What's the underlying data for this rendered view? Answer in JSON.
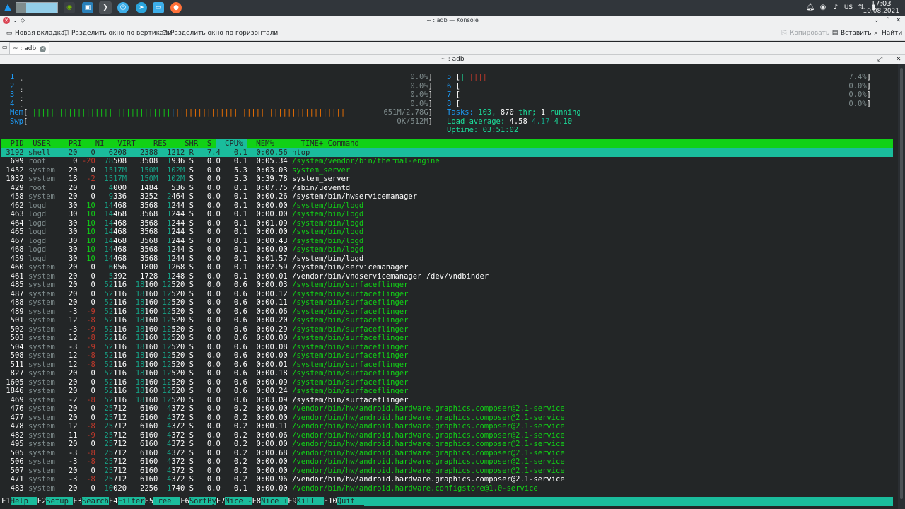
{
  "taskbar": {
    "clock_time": "17:03",
    "clock_date": "10.08.2021",
    "keyboard_layout": "US",
    "icons": [
      "kde-menu-icon",
      "desktop-pager-icon",
      "nvidia-icon",
      "terminal-app-icon",
      "konsole-icon",
      "browser-icon",
      "telegram-icon",
      "file-manager-icon",
      "firefox-icon"
    ],
    "tray_icons": [
      "notifications-icon",
      "media-icon",
      "volume-icon",
      "network-icon",
      "battery-icon"
    ]
  },
  "window": {
    "title": "~ : adb — Konsole"
  },
  "toolbar": {
    "new_tab": "Новая вкладка",
    "split_vertical": "Разделить окно по вертикали",
    "split_horizontal": "Разделить окно по горизонтали",
    "copy": "Копировать",
    "paste": "Вставить",
    "find": "Найти"
  },
  "tab": {
    "label": "~ : adb"
  },
  "session": {
    "title": "~ : adb"
  },
  "meters": {
    "cpus": [
      {
        "n": "1",
        "bar": "",
        "pct": "0.0%"
      },
      {
        "n": "2",
        "bar": "",
        "pct": "0.0%"
      },
      {
        "n": "3",
        "bar": "",
        "pct": "0.0%"
      },
      {
        "n": "4",
        "bar": "",
        "pct": "0.0%"
      },
      {
        "n": "5",
        "bar": "||||||",
        "pct": "7.4%"
      },
      {
        "n": "6",
        "bar": "",
        "pct": "0.0%"
      },
      {
        "n": "7",
        "bar": "",
        "pct": "0.0%"
      },
      {
        "n": "8",
        "bar": "",
        "pct": "0.0%"
      }
    ],
    "mem": {
      "label": "Mem",
      "bar_green": "||||||||||||||||||||||||||||||||",
      "bar_blue": "|",
      "bar_orange": "||||||||||||||||||||||||||||||||||||||",
      "value": "651M/2.78G"
    },
    "swp": {
      "label": "Swp",
      "value": "0K/512M"
    },
    "tasks": {
      "label": "Tasks:",
      "count": "103,",
      "thr": "870",
      "thr_label": "thr;",
      "running": "1",
      "running_label": "running"
    },
    "load": {
      "label": "Load average:",
      "l1": "4.58",
      "l5": "4.17",
      "l15": "4.10"
    },
    "uptime": {
      "label": "Uptime:",
      "value": "03:51:02"
    }
  },
  "columns": [
    "PID",
    "USER",
    "PRI",
    "NI",
    "VIRT",
    "RES",
    "SHR",
    "S",
    "CPU%",
    "MEM%",
    "TIME+",
    "Command"
  ],
  "processes": [
    [
      "3192",
      "shell",
      "20",
      "0",
      "6208",
      "2388",
      "1212",
      "R",
      "7.4",
      "0.1",
      "0:00.56",
      "htop"
    ],
    [
      "699",
      "root",
      "0",
      "-20",
      "78508",
      "3508",
      "1936",
      "S",
      "0.0",
      "0.1",
      "0:05.34",
      "/system/vendor/bin/thermal-engine"
    ],
    [
      "1452",
      "system",
      "20",
      "0",
      "1517M",
      "150M",
      "102M",
      "S",
      "0.0",
      "5.3",
      "0:03.03",
      "system_server"
    ],
    [
      "1032",
      "system",
      "18",
      "-2",
      "1517M",
      "150M",
      "102M",
      "S",
      "0.0",
      "5.3",
      "0:39.78",
      "system_server"
    ],
    [
      "429",
      "root",
      "20",
      "0",
      "4000",
      "1484",
      "536",
      "S",
      "0.0",
      "0.1",
      "0:07.75",
      "/sbin/ueventd"
    ],
    [
      "458",
      "system",
      "20",
      "0",
      "9336",
      "3252",
      "2464",
      "S",
      "0.0",
      "0.1",
      "0:00.26",
      "/system/bin/hwservicemanager"
    ],
    [
      "462",
      "logd",
      "30",
      "10",
      "14468",
      "3568",
      "1244",
      "S",
      "0.0",
      "0.1",
      "0:00.00",
      "/system/bin/logd"
    ],
    [
      "463",
      "logd",
      "30",
      "10",
      "14468",
      "3568",
      "1244",
      "S",
      "0.0",
      "0.1",
      "0:00.00",
      "/system/bin/logd"
    ],
    [
      "464",
      "logd",
      "30",
      "10",
      "14468",
      "3568",
      "1244",
      "S",
      "0.0",
      "0.1",
      "0:01.09",
      "/system/bin/logd"
    ],
    [
      "465",
      "logd",
      "30",
      "10",
      "14468",
      "3568",
      "1244",
      "S",
      "0.0",
      "0.1",
      "0:00.00",
      "/system/bin/logd"
    ],
    [
      "467",
      "logd",
      "30",
      "10",
      "14468",
      "3568",
      "1244",
      "S",
      "0.0",
      "0.1",
      "0:00.43",
      "/system/bin/logd"
    ],
    [
      "468",
      "logd",
      "30",
      "10",
      "14468",
      "3568",
      "1244",
      "S",
      "0.0",
      "0.1",
      "0:00.00",
      "/system/bin/logd"
    ],
    [
      "459",
      "logd",
      "30",
      "10",
      "14468",
      "3568",
      "1244",
      "S",
      "0.0",
      "0.1",
      "0:01.57",
      "/system/bin/logd"
    ],
    [
      "460",
      "system",
      "20",
      "0",
      "6056",
      "1800",
      "1268",
      "S",
      "0.0",
      "0.1",
      "0:02.59",
      "/system/bin/servicemanager"
    ],
    [
      "461",
      "system",
      "20",
      "0",
      "5392",
      "1728",
      "1248",
      "S",
      "0.0",
      "0.1",
      "0:00.01",
      "/vendor/bin/vndservicemanager /dev/vndbinder"
    ],
    [
      "485",
      "system",
      "20",
      "0",
      "52116",
      "18160",
      "12520",
      "S",
      "0.0",
      "0.6",
      "0:00.03",
      "/system/bin/surfaceflinger"
    ],
    [
      "487",
      "system",
      "20",
      "0",
      "52116",
      "18160",
      "12520",
      "S",
      "0.0",
      "0.6",
      "0:00.12",
      "/system/bin/surfaceflinger"
    ],
    [
      "488",
      "system",
      "20",
      "0",
      "52116",
      "18160",
      "12520",
      "S",
      "0.0",
      "0.6",
      "0:00.11",
      "/system/bin/surfaceflinger"
    ],
    [
      "489",
      "system",
      "-3",
      "-9",
      "52116",
      "18160",
      "12520",
      "S",
      "0.0",
      "0.6",
      "0:00.06",
      "/system/bin/surfaceflinger"
    ],
    [
      "501",
      "system",
      "12",
      "-8",
      "52116",
      "18160",
      "12520",
      "S",
      "0.0",
      "0.6",
      "0:00.20",
      "/system/bin/surfaceflinger"
    ],
    [
      "502",
      "system",
      "-3",
      "-9",
      "52116",
      "18160",
      "12520",
      "S",
      "0.0",
      "0.6",
      "0:00.29",
      "/system/bin/surfaceflinger"
    ],
    [
      "503",
      "system",
      "12",
      "-8",
      "52116",
      "18160",
      "12520",
      "S",
      "0.0",
      "0.6",
      "0:00.00",
      "/system/bin/surfaceflinger"
    ],
    [
      "504",
      "system",
      "-3",
      "-9",
      "52116",
      "18160",
      "12520",
      "S",
      "0.0",
      "0.6",
      "0:00.08",
      "/system/bin/surfaceflinger"
    ],
    [
      "508",
      "system",
      "12",
      "-8",
      "52116",
      "18160",
      "12520",
      "S",
      "0.0",
      "0.6",
      "0:00.00",
      "/system/bin/surfaceflinger"
    ],
    [
      "511",
      "system",
      "12",
      "-8",
      "52116",
      "18160",
      "12520",
      "S",
      "0.0",
      "0.6",
      "0:00.01",
      "/system/bin/surfaceflinger"
    ],
    [
      "827",
      "system",
      "20",
      "0",
      "52116",
      "18160",
      "12520",
      "S",
      "0.0",
      "0.6",
      "0:00.18",
      "/system/bin/surfaceflinger"
    ],
    [
      "1605",
      "system",
      "20",
      "0",
      "52116",
      "18160",
      "12520",
      "S",
      "0.0",
      "0.6",
      "0:00.09",
      "/system/bin/surfaceflinger"
    ],
    [
      "1846",
      "system",
      "20",
      "0",
      "52116",
      "18160",
      "12520",
      "S",
      "0.0",
      "0.6",
      "0:00.24",
      "/system/bin/surfaceflinger"
    ],
    [
      "469",
      "system",
      "-2",
      "-8",
      "52116",
      "18160",
      "12520",
      "S",
      "0.0",
      "0.6",
      "0:03.09",
      "/system/bin/surfaceflinger"
    ],
    [
      "476",
      "system",
      "20",
      "0",
      "25712",
      "6160",
      "4372",
      "S",
      "0.0",
      "0.2",
      "0:00.00",
      "/vendor/bin/hw/android.hardware.graphics.composer@2.1-service"
    ],
    [
      "477",
      "system",
      "20",
      "0",
      "25712",
      "6160",
      "4372",
      "S",
      "0.0",
      "0.2",
      "0:00.00",
      "/vendor/bin/hw/android.hardware.graphics.composer@2.1-service"
    ],
    [
      "478",
      "system",
      "12",
      "-8",
      "25712",
      "6160",
      "4372",
      "S",
      "0.0",
      "0.2",
      "0:00.11",
      "/vendor/bin/hw/android.hardware.graphics.composer@2.1-service"
    ],
    [
      "482",
      "system",
      "11",
      "-9",
      "25712",
      "6160",
      "4372",
      "S",
      "0.0",
      "0.2",
      "0:00.06",
      "/vendor/bin/hw/android.hardware.graphics.composer@2.1-service"
    ],
    [
      "495",
      "system",
      "20",
      "0",
      "25712",
      "6160",
      "4372",
      "S",
      "0.0",
      "0.2",
      "0:00.00",
      "/vendor/bin/hw/android.hardware.graphics.composer@2.1-service"
    ],
    [
      "505",
      "system",
      "-3",
      "-8",
      "25712",
      "6160",
      "4372",
      "S",
      "0.0",
      "0.2",
      "0:00.68",
      "/vendor/bin/hw/android.hardware.graphics.composer@2.1-service"
    ],
    [
      "506",
      "system",
      "-3",
      "-8",
      "25712",
      "6160",
      "4372",
      "S",
      "0.0",
      "0.2",
      "0:00.00",
      "/vendor/bin/hw/android.hardware.graphics.composer@2.1-service"
    ],
    [
      "507",
      "system",
      "20",
      "0",
      "25712",
      "6160",
      "4372",
      "S",
      "0.0",
      "0.2",
      "0:00.00",
      "/vendor/bin/hw/android.hardware.graphics.composer@2.1-service"
    ],
    [
      "471",
      "system",
      "-3",
      "-8",
      "25712",
      "6160",
      "4372",
      "S",
      "0.0",
      "0.2",
      "0:00.96",
      "/vendor/bin/hw/android.hardware.graphics.composer@2.1-service"
    ],
    [
      "483",
      "system",
      "20",
      "0",
      "10020",
      "2256",
      "1740",
      "S",
      "0.0",
      "0.1",
      "0:00.00",
      "/vendor/bin/hw/android.hardware.configstore@1.0-service"
    ]
  ],
  "thread_rows": [
    1,
    2,
    6,
    7,
    8,
    9,
    10,
    11,
    15,
    16,
    17,
    18,
    19,
    20,
    21,
    22,
    23,
    24,
    25,
    26,
    27,
    29,
    30,
    31,
    32,
    33,
    34,
    35,
    36,
    38
  ],
  "function_keys": [
    {
      "key": "F1",
      "label": "Help  "
    },
    {
      "key": "F2",
      "label": "Setup "
    },
    {
      "key": "F3",
      "label": "Search"
    },
    {
      "key": "F4",
      "label": "Filter"
    },
    {
      "key": "F5",
      "label": "Tree  "
    },
    {
      "key": "F6",
      "label": "SortBy"
    },
    {
      "key": "F7",
      "label": "Nice -"
    },
    {
      "key": "F8",
      "label": "Nice +"
    },
    {
      "key": "F9",
      "label": "Kill  "
    },
    {
      "key": "F10",
      "label": "Quit  "
    }
  ],
  "colors": {
    "terminal_bg": "#232627",
    "header_green": "#11d116",
    "selected_teal": "#1abc9c",
    "thread_green": "#11d116",
    "user_gray": "#7f8c8d",
    "negative_red": "#c0392b"
  }
}
